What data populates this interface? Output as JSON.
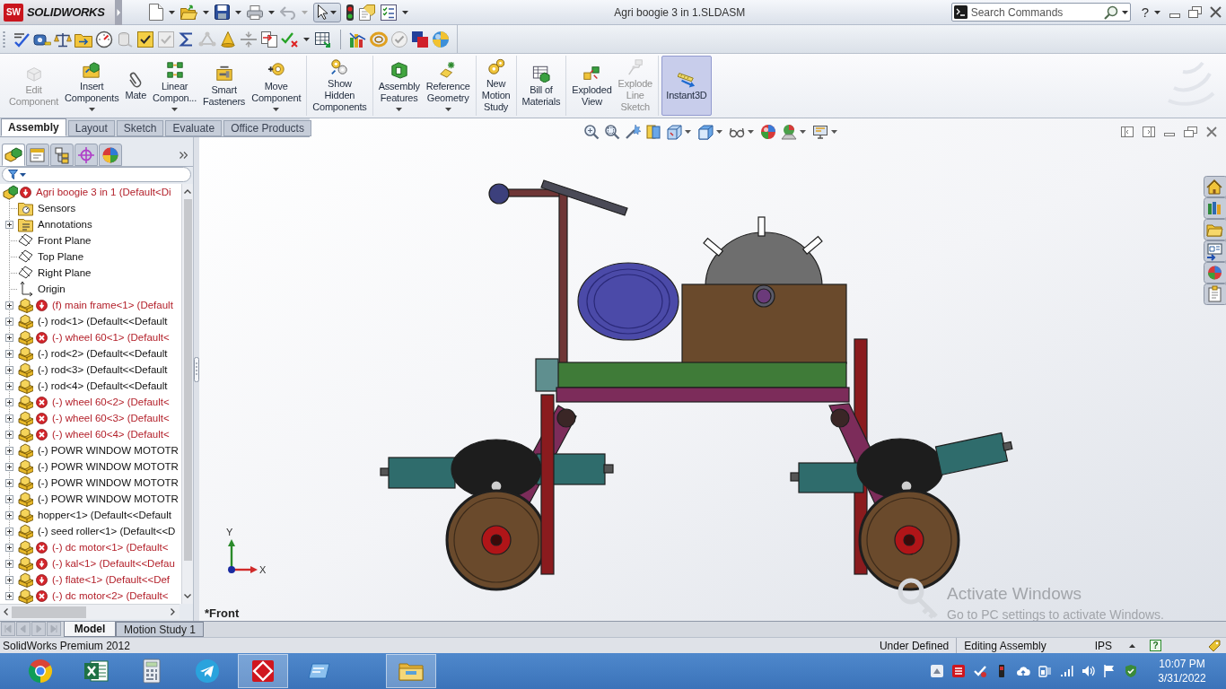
{
  "title_bar": {
    "logo_badge": "SW",
    "app_name": "SOLIDWORKS",
    "document_title": "Agri boogie 3 in 1.SLDASM",
    "search": {
      "placeholder": "Search Commands"
    },
    "help": "?"
  },
  "command_manager": {
    "groups": [
      {
        "buttons": [
          {
            "label": "Edit\nComponent",
            "disabled": true,
            "dropdown": false,
            "selected": false
          },
          {
            "label": "Insert\nComponents",
            "disabled": false,
            "dropdown": true,
            "selected": false
          },
          {
            "label": "Mate",
            "disabled": false,
            "dropdown": false,
            "selected": false
          },
          {
            "label": "Linear\nCompon...",
            "disabled": false,
            "dropdown": true,
            "selected": false
          },
          {
            "label": "Smart\nFasteners",
            "disabled": false,
            "dropdown": false,
            "selected": false
          },
          {
            "label": "Move\nComponent",
            "disabled": false,
            "dropdown": true,
            "selected": false
          }
        ]
      },
      {
        "buttons": [
          {
            "label": "Show\nHidden\nComponents",
            "disabled": false,
            "dropdown": false,
            "selected": false
          }
        ]
      },
      {
        "buttons": [
          {
            "label": "Assembly\nFeatures",
            "disabled": false,
            "dropdown": true,
            "selected": false
          },
          {
            "label": "Reference\nGeometry",
            "disabled": false,
            "dropdown": true,
            "selected": false
          }
        ]
      },
      {
        "buttons": [
          {
            "label": "New\nMotion\nStudy",
            "disabled": false,
            "dropdown": false,
            "selected": false
          }
        ]
      },
      {
        "buttons": [
          {
            "label": "Bill of\nMaterials",
            "disabled": false,
            "dropdown": false,
            "selected": false
          }
        ]
      },
      {
        "buttons": [
          {
            "label": "Exploded\nView",
            "disabled": false,
            "dropdown": false,
            "selected": false
          },
          {
            "label": "Explode\nLine\nSketch",
            "disabled": true,
            "dropdown": false,
            "selected": false
          }
        ]
      },
      {
        "buttons": [
          {
            "label": "Instant3D",
            "disabled": false,
            "dropdown": false,
            "selected": true
          }
        ]
      }
    ]
  },
  "tabs": [
    {
      "label": "Assembly",
      "selected": true
    },
    {
      "label": "Layout",
      "selected": false
    },
    {
      "label": "Sketch",
      "selected": false
    },
    {
      "label": "Evaluate",
      "selected": false
    },
    {
      "label": "Office Products",
      "selected": false
    }
  ],
  "feature_manager": {
    "panel_tabs": [
      {
        "selected": true
      },
      {
        "selected": false
      },
      {
        "selected": false
      },
      {
        "selected": false
      },
      {
        "selected": false
      }
    ],
    "tree": {
      "label": "Agri boogie 3 in 1 (Default<Di",
      "kind": "assembly",
      "error": false,
      "warning": true,
      "children": [
        {
          "label": "Sensors",
          "kind": "sensors",
          "error": false,
          "warning": false,
          "expandable": false
        },
        {
          "label": "Annotations",
          "kind": "annotations",
          "error": false,
          "warning": false,
          "expandable": true
        },
        {
          "label": "Front Plane",
          "kind": "plane",
          "error": false,
          "warning": false,
          "expandable": false
        },
        {
          "label": "Top Plane",
          "kind": "plane",
          "error": false,
          "warning": false,
          "expandable": false
        },
        {
          "label": "Right Plane",
          "kind": "plane",
          "error": false,
          "warning": false,
          "expandable": false
        },
        {
          "label": "Origin",
          "kind": "origin",
          "error": false,
          "warning": false,
          "expandable": false
        },
        {
          "label": "(f) main frame<1> (Default",
          "kind": "component",
          "error": false,
          "warning": true,
          "expandable": true
        },
        {
          "label": "(-) rod<1> (Default<<Default",
          "kind": "component",
          "error": false,
          "warning": false,
          "expandable": true
        },
        {
          "label": "(-) wheel 60<1> (Default<",
          "kind": "component",
          "error": true,
          "warning": false,
          "expandable": true
        },
        {
          "label": "(-) rod<2> (Default<<Default",
          "kind": "component",
          "error": false,
          "warning": false,
          "expandable": true
        },
        {
          "label": "(-) rod<3> (Default<<Default",
          "kind": "component",
          "error": false,
          "warning": false,
          "expandable": true
        },
        {
          "label": "(-) rod<4> (Default<<Default",
          "kind": "component",
          "error": false,
          "warning": false,
          "expandable": true
        },
        {
          "label": "(-) wheel 60<2> (Default<",
          "kind": "component",
          "error": true,
          "warning": false,
          "expandable": true
        },
        {
          "label": "(-) wheel 60<3> (Default<",
          "kind": "component",
          "error": true,
          "warning": false,
          "expandable": true
        },
        {
          "label": "(-) wheel 60<4> (Default<",
          "kind": "component",
          "error": true,
          "warning": false,
          "expandable": true
        },
        {
          "label": "(-) POWR WINDOW MOTOTR",
          "kind": "component",
          "error": false,
          "warning": false,
          "expandable": true
        },
        {
          "label": "(-) POWR WINDOW MOTOTR",
          "kind": "component",
          "error": false,
          "warning": false,
          "expandable": true
        },
        {
          "label": "(-) POWR WINDOW MOTOTR",
          "kind": "component",
          "error": false,
          "warning": false,
          "expandable": true
        },
        {
          "label": "(-) POWR WINDOW MOTOTR",
          "kind": "component",
          "error": false,
          "warning": false,
          "expandable": true
        },
        {
          "label": "hopper<1> (Default<<Default",
          "kind": "component",
          "error": false,
          "warning": false,
          "expandable": true
        },
        {
          "label": "(-) seed roller<1> (Default<<D",
          "kind": "component",
          "error": false,
          "warning": false,
          "expandable": true
        },
        {
          "label": "(-) dc motor<1> (Default<",
          "kind": "component",
          "error": true,
          "warning": false,
          "expandable": true
        },
        {
          "label": "(-) kal<1> (Default<<Defau",
          "kind": "component",
          "error": false,
          "warning": true,
          "expandable": true
        },
        {
          "label": "(-) flate<1> (Default<<Def",
          "kind": "component",
          "error": false,
          "warning": true,
          "expandable": true
        },
        {
          "label": "(-) dc motor<2> (Default<",
          "kind": "component",
          "error": true,
          "warning": false,
          "expandable": true
        }
      ]
    }
  },
  "graphics": {
    "view_name": "*Front",
    "triad": {
      "x_label": "X",
      "y_label": "Y"
    }
  },
  "activation_notice": {
    "title": "Activate Windows",
    "text": "Go to PC settings to activate Windows."
  },
  "bottom_tabs": [
    {
      "label": "Model",
      "selected": true
    },
    {
      "label": "Motion Study 1",
      "selected": false
    }
  ],
  "status_bar": {
    "product": "SolidWorks Premium 2012",
    "rebuild_state": "Under Defined",
    "mode": "Editing Assembly",
    "units": "IPS",
    "help": "?"
  },
  "taskbar": {
    "apps": [
      {
        "active": false
      },
      {
        "active": false
      },
      {
        "active": false
      },
      {
        "active": false
      },
      {
        "active": true
      },
      {
        "active": false
      },
      {
        "active": true
      }
    ],
    "clock": {
      "time": "10:07 PM",
      "date": "3/31/2022"
    }
  }
}
